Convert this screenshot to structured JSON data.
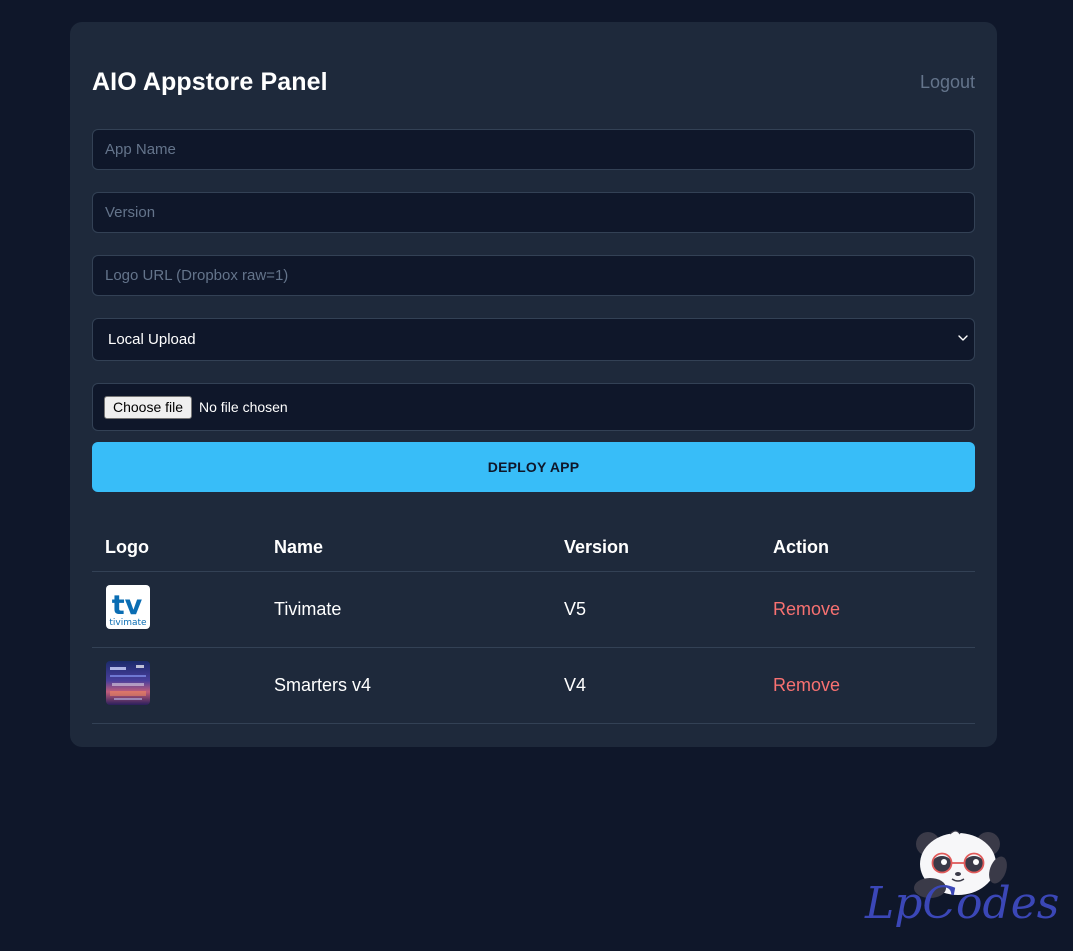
{
  "header": {
    "title": "AIO Appstore Panel",
    "logout_label": "Logout"
  },
  "form": {
    "app_name_placeholder": "App Name",
    "version_placeholder": "Version",
    "logo_url_placeholder": "Logo URL (Dropbox raw=1)",
    "source_select": {
      "selected": "Local Upload"
    },
    "file_input": {
      "button_label": "Choose file",
      "status": "No file chosen"
    },
    "deploy_label": "DEPLOY APP"
  },
  "table": {
    "headers": {
      "logo": "Logo",
      "name": "Name",
      "version": "Version",
      "action": "Action"
    },
    "rows": [
      {
        "logo_icon": "tivimate-logo",
        "name": "Tivimate",
        "version": "V5",
        "action": "Remove"
      },
      {
        "logo_icon": "smarters-logo",
        "name": "Smarters v4",
        "version": "V4",
        "action": "Remove"
      }
    ]
  },
  "watermark": {
    "text": "LpCodes",
    "icon": "panda-mascot-icon"
  },
  "colors": {
    "background": "#0f172a",
    "panel": "#1e293b",
    "accent": "#38bdf8",
    "danger": "#f87171",
    "muted": "#64748b"
  }
}
